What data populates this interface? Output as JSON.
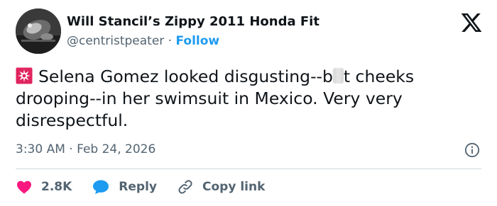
{
  "author": {
    "display_name": "Will Stancil’s Zippy 2011 Honda Fit",
    "handle": "@centristpeater",
    "separator": "·",
    "follow_label": "Follow"
  },
  "brand": {
    "logo_icon": "x-logo-icon"
  },
  "tweet": {
    "text_before": "Selena Gomez looked disgusting--b",
    "text_obscured": "u",
    "text_after": "t cheeks drooping--in her swimsuit in Mexico. Very very disrespectful.",
    "leading_emoji": "police-siren-icon"
  },
  "meta": {
    "time": "3:30 AM",
    "separator": "·",
    "date": "Feb 24, 2026"
  },
  "actions": {
    "like_count": "2.8K",
    "reply_label": "Reply",
    "copy_label": "Copy link"
  },
  "colors": {
    "accent": "#1d9bf0",
    "like": "#f91880",
    "text": "#0f1419",
    "secondary": "#536471",
    "divider": "#cfd9de"
  }
}
